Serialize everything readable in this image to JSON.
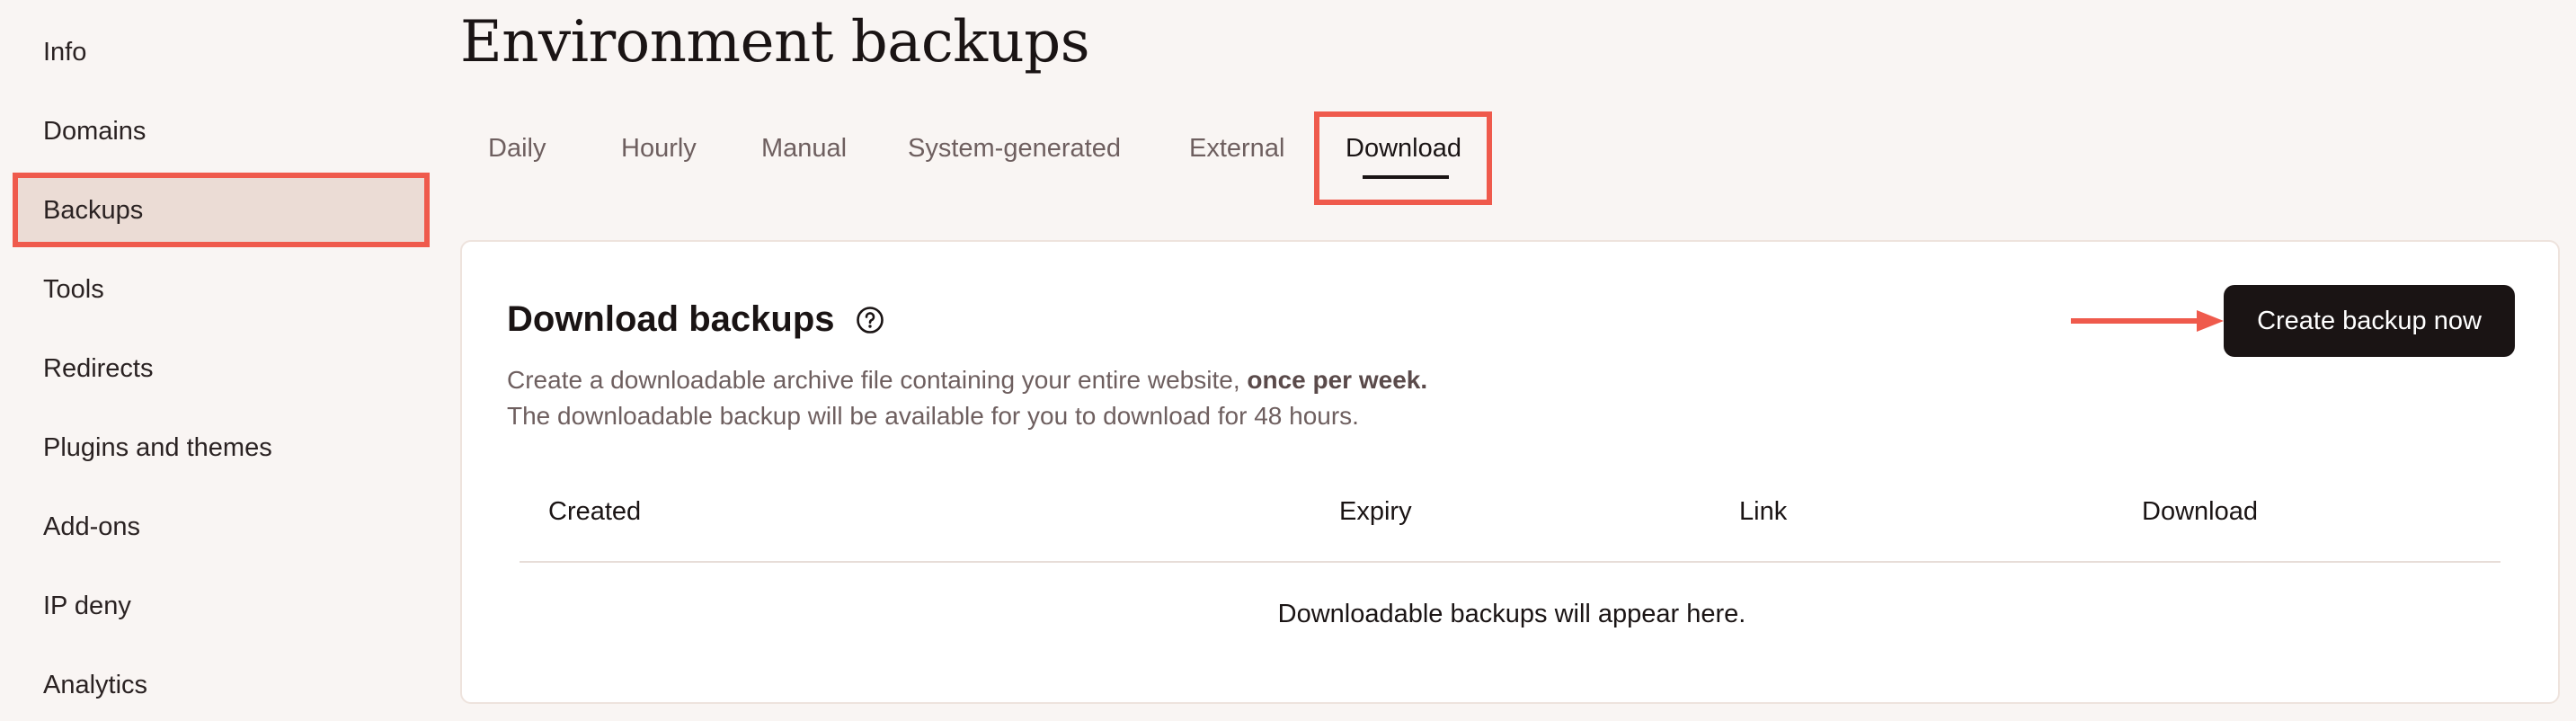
{
  "sidebar": {
    "items": [
      {
        "label": "Info"
      },
      {
        "label": "Domains"
      },
      {
        "label": "Backups"
      },
      {
        "label": "Tools"
      },
      {
        "label": "Redirects"
      },
      {
        "label": "Plugins and themes"
      },
      {
        "label": "Add-ons"
      },
      {
        "label": "IP deny"
      },
      {
        "label": "Analytics"
      }
    ],
    "active": "Backups"
  },
  "page": {
    "title": "Environment backups"
  },
  "tabs": [
    {
      "label": "Daily"
    },
    {
      "label": "Hourly"
    },
    {
      "label": "Manual"
    },
    {
      "label": "System-generated"
    },
    {
      "label": "External"
    },
    {
      "label": "Download"
    }
  ],
  "active_tab": "Download",
  "card": {
    "title": "Download backups",
    "desc_line1_prefix": "Create a downloadable archive file containing your entire website, ",
    "desc_line1_bold": "once per week.",
    "desc_line2": "The downloadable backup will be available for you to download for 48 hours.",
    "create_button": "Create backup now",
    "table_headers": [
      "Created",
      "Expiry",
      "Link",
      "Download"
    ],
    "empty_message": "Downloadable backups will appear here."
  },
  "colors": {
    "highlight": "#ef5a4c",
    "active_bg": "#ebdcd5",
    "button_bg": "#1a1414"
  }
}
